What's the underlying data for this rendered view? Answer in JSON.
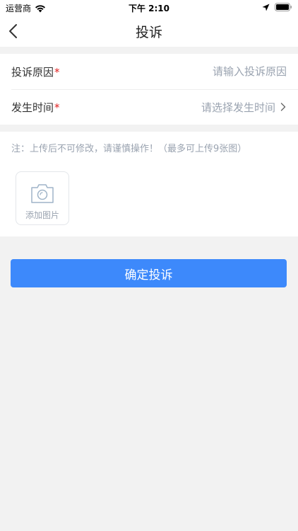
{
  "status_bar": {
    "carrier": "运营商",
    "time": "下午 2:10"
  },
  "nav": {
    "title": "投诉",
    "icons": [
      "back-icon"
    ]
  },
  "form": {
    "reason": {
      "label": "投诉原因",
      "required_mark": "*",
      "value": "",
      "placeholder": "请输入投诉原因"
    },
    "time": {
      "label": "发生时间",
      "required_mark": "*",
      "placeholder": "请选择发生时间"
    }
  },
  "upload": {
    "note": "注：上传后不可修改，请谨慎操作！（最多可上传9张图）",
    "add_label": "添加图片",
    "icon": "camera-icon"
  },
  "submit": {
    "label": "确定投诉"
  },
  "colors": {
    "accent": "#3d89fb",
    "required": "#e02020",
    "placeholder": "#9aa3b0",
    "background": "#f2f2f2"
  }
}
